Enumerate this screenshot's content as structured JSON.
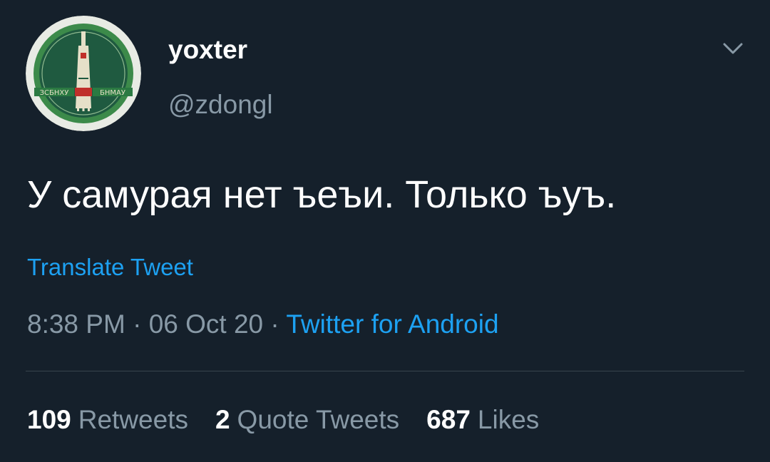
{
  "tweet": {
    "display_name": "yoxter",
    "handle": "@zdongl",
    "text": "У самурая нет ъеъи. Только ъуъ.",
    "translate_label": "Translate Tweet",
    "time": "8:38 PM",
    "separator": "·",
    "date": "06 Oct 20",
    "source": "Twitter for Android"
  },
  "avatar": {
    "left_text": "ЗСБНХУ",
    "right_text": "БНМАУ",
    "ring_color": "#3c8a4a",
    "face_color": "#1f5a40"
  },
  "stats": [
    {
      "count": "109",
      "label": "Retweets"
    },
    {
      "count": "2",
      "label": "Quote Tweets"
    },
    {
      "count": "687",
      "label": "Likes"
    }
  ],
  "colors": {
    "background": "#15202b",
    "link": "#1da1f2",
    "secondary_text": "#8899a6",
    "divider": "#38444d"
  },
  "icons": {
    "caret": "chevron-down-icon"
  }
}
